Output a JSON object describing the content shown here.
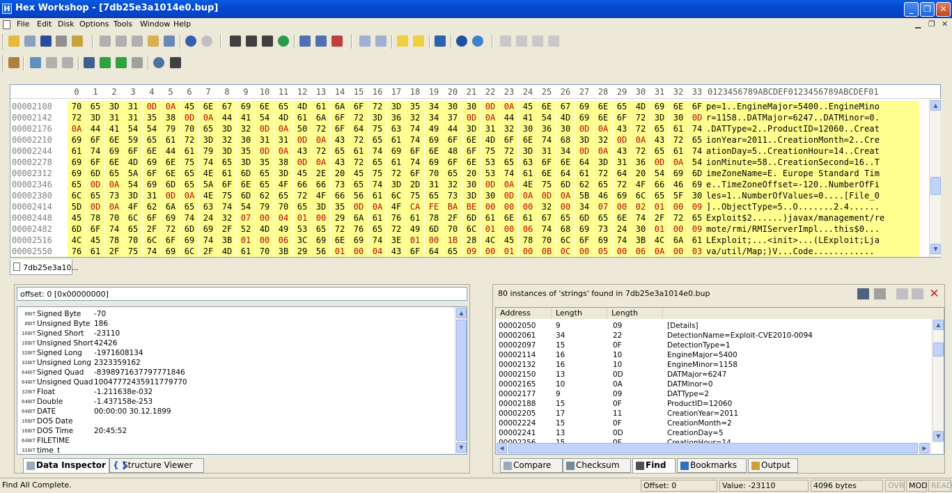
{
  "window": {
    "title": "Hex Workshop - [7db25e3a1014e0.bup]"
  },
  "menu": {
    "items": [
      "File",
      "Edit",
      "Disk",
      "Options",
      "Tools",
      "Window",
      "Help"
    ]
  },
  "hex": {
    "col_header": [
      "0",
      "1",
      "2",
      "3",
      "4",
      "5",
      "6",
      "7",
      "8",
      "9",
      "10",
      "11",
      "12",
      "13",
      "14",
      "15",
      "16",
      "17",
      "18",
      "19",
      "20",
      "21",
      "22",
      "23",
      "24",
      "25",
      "26",
      "27",
      "28",
      "29",
      "30",
      "31",
      "32",
      "33"
    ],
    "ascii_header": "0123456789ABCDEF0123456789ABCDEF01",
    "rows": [
      {
        "addr": "00002108",
        "bytes": "70 65 3D 31 0D 0A 45 6E 67 69 6E 65 4D 61 6A 6F 72 3D 35 34 30 30 0D 0A 45 6E 67 69 6E 65 4D 69 6E 6F",
        "ascii": "pe=1..EngineMajor=5400..EngineMino"
      },
      {
        "addr": "00002142",
        "bytes": "72 3D 31 31 35 38 0D 0A 44 41 54 4D 61 6A 6F 72 3D 36 32 34 37 0D 0A 44 41 54 4D 69 6E 6F 72 3D 30 0D",
        "ascii": "r=1158..DATMajor=6247..DATMinor=0."
      },
      {
        "addr": "00002176",
        "bytes": "0A 44 41 54 54 79 70 65 3D 32 0D 0A 50 72 6F 64 75 63 74 49 44 3D 31 32 30 36 30 0D 0A 43 72 65 61 74",
        "ascii": ".DATType=2..ProductID=12060..Creat"
      },
      {
        "addr": "00002210",
        "bytes": "69 6F 6E 59 65 61 72 3D 32 30 31 31 0D 0A 43 72 65 61 74 69 6F 6E 4D 6F 6E 74 68 3D 32 0D 0A 43 72 65",
        "ascii": "ionYear=2011..CreationMonth=2..Cre"
      },
      {
        "addr": "00002244",
        "bytes": "61 74 69 6F 6E 44 61 79 3D 35 0D 0A 43 72 65 61 74 69 6F 6E 48 6F 75 72 3D 31 34 0D 0A 43 72 65 61 74",
        "ascii": "ationDay=5..CreationHour=14..Creat"
      },
      {
        "addr": "00002278",
        "bytes": "69 6F 6E 4D 69 6E 75 74 65 3D 35 38 0D 0A 43 72 65 61 74 69 6F 6E 53 65 63 6F 6E 64 3D 31 36 0D 0A 54",
        "ascii": "ionMinute=58..CreationSecond=16..T"
      },
      {
        "addr": "00002312",
        "bytes": "69 6D 65 5A 6F 6E 65 4E 61 6D 65 3D 45 2E 20 45 75 72 6F 70 65 20 53 74 61 6E 64 61 72 64 20 54 69 6D",
        "ascii": "imeZoneName=E. Europe Standard Tim"
      },
      {
        "addr": "00002346",
        "bytes": "65 0D 0A 54 69 6D 65 5A 6F 6E 65 4F 66 66 73 65 74 3D 2D 31 32 30 0D 0A 4E 75 6D 62 65 72 4F 66 46 69",
        "ascii": "e..TimeZoneOffset=-120..NumberOfFi"
      },
      {
        "addr": "00002380",
        "bytes": "6C 65 73 3D 31 0D 0A 4E 75 6D 62 65 72 4F 66 56 61 6C 75 65 73 3D 30 0D 0A 0D 0A 5B 46 69 6C 65 5F 30",
        "ascii": "les=1..NumberOfValues=0....[File_0"
      },
      {
        "addr": "00002414",
        "bytes": "5D 0D 0A 4F 62 6A 65 63 74 54 79 70 65 3D 35 0D 0A 4F CA FE BA BE 00 00 00 32 00 34 07 00 02 01 00 09",
        "ascii": "]..ObjectType=5..O.......2.4......"
      },
      {
        "addr": "00002448",
        "bytes": "45 78 70 6C 6F 69 74 24 32 07 00 04 01 00 29 6A 61 76 61 78 2F 6D 61 6E 61 67 65 6D 65 6E 74 2F 72 65",
        "ascii": "Exploit$2......)javax/management/re"
      },
      {
        "addr": "00002482",
        "bytes": "6D 6F 74 65 2F 72 6D 69 2F 52 4D 49 53 65 72 76 65 72 49 6D 70 6C 01 00 06 74 68 69 73 24 30 01 00 09",
        "ascii": "mote/rmi/RMIServerImpl...this$0..."
      },
      {
        "addr": "00002516",
        "bytes": "4C 45 78 70 6C 6F 69 74 3B 01 00 06 3C 69 6E 69 74 3E 01 00 1B 28 4C 45 78 70 6C 6F 69 74 3B 4C 6A 61",
        "ascii": "LExploit;...<init>...(LExploit;Lja"
      },
      {
        "addr": "00002550",
        "bytes": "76 61 2F 75 74 69 6C 2F 4D 61 70 3B 29 56 01 00 04 43 6F 64 65 09 00 01 00 0B 0C 00 05 00 06 0A 00 03",
        "ascii": "va/util/Map;)V...Code............"
      }
    ]
  },
  "doc_tab": {
    "label": "7db25e3a10..."
  },
  "inspector": {
    "header": "offset: 0 [0x00000000]",
    "rows": [
      {
        "bits": "8BIT",
        "name": "Signed Byte",
        "value": "-70"
      },
      {
        "bits": "8BIT",
        "name": "Unsigned Byte",
        "value": "186"
      },
      {
        "bits": "16BIT",
        "name": "Signed Short",
        "value": "-23110"
      },
      {
        "bits": "16BIT",
        "name": "Unsigned Short",
        "value": "42426"
      },
      {
        "bits": "32BIT",
        "name": "Signed Long",
        "value": "-1971608134"
      },
      {
        "bits": "32BIT",
        "name": "Unsigned Long",
        "value": "2323359162"
      },
      {
        "bits": "64BIT",
        "name": "Signed Quad",
        "value": "-8398971637797771846"
      },
      {
        "bits": "64BIT",
        "name": "Unsigned Quad",
        "value": "10047772435911779770"
      },
      {
        "bits": "32BIT",
        "name": "Float",
        "value": "-1.211638e-032"
      },
      {
        "bits": "64BIT",
        "name": "Double",
        "value": "-1.437158e-253"
      },
      {
        "bits": "64BIT",
        "name": "DATE",
        "value": "00:00:00 30.12.1899"
      },
      {
        "bits": "16BIT",
        "name": "DOS Date",
        "value": ""
      },
      {
        "bits": "16BIT",
        "name": "DOS Time",
        "value": "20:45:52"
      },
      {
        "bits": "64BIT",
        "name": "FILETIME",
        "value": ""
      },
      {
        "bits": "32BIT",
        "name": "time_t",
        "value": ""
      }
    ],
    "tabs": [
      "Data Inspector",
      "Structure Viewer"
    ]
  },
  "find": {
    "header": "80 instances of 'strings' found in 7db25e3a1014e0.bup",
    "columns": [
      "Address",
      "Length",
      "Length"
    ],
    "rows": [
      {
        "addr": "00002050",
        "len": "9",
        "hex": "09",
        "text": "[Details]"
      },
      {
        "addr": "00002061",
        "len": "34",
        "hex": "22",
        "text": "DetectionName=Exploit-CVE2010-0094"
      },
      {
        "addr": "00002097",
        "len": "15",
        "hex": "0F",
        "text": "DetectionType=1"
      },
      {
        "addr": "00002114",
        "len": "16",
        "hex": "10",
        "text": "EngineMajor=5400"
      },
      {
        "addr": "00002132",
        "len": "16",
        "hex": "10",
        "text": "EngineMinor=1158"
      },
      {
        "addr": "00002150",
        "len": "13",
        "hex": "0D",
        "text": "DATMajor=6247"
      },
      {
        "addr": "00002165",
        "len": "10",
        "hex": "0A",
        "text": "DATMinor=0"
      },
      {
        "addr": "00002177",
        "len": "9",
        "hex": "09",
        "text": "DATType=2"
      },
      {
        "addr": "00002188",
        "len": "15",
        "hex": "0F",
        "text": "ProductID=12060"
      },
      {
        "addr": "00002205",
        "len": "17",
        "hex": "11",
        "text": "CreationYear=2011"
      },
      {
        "addr": "00002224",
        "len": "15",
        "hex": "0F",
        "text": "CreationMonth=2"
      },
      {
        "addr": "00002241",
        "len": "13",
        "hex": "0D",
        "text": "CreationDay=5"
      },
      {
        "addr": "00002256",
        "len": "15",
        "hex": "0F",
        "text": "CreationHour=14"
      }
    ],
    "tabs": [
      "Compare",
      "Checksum",
      "Find",
      "Bookmarks",
      "Output"
    ]
  },
  "status": {
    "message": "Find All Complete.",
    "offset": "Offset: 0",
    "value": "Value: -23110",
    "size": "4096 bytes",
    "ovr": "OVR",
    "mod": "MOD",
    "read": "READ"
  },
  "colors": {
    "highlight": "#ffff90",
    "crlf": "#c00000",
    "titlebar": "#0548d3"
  }
}
